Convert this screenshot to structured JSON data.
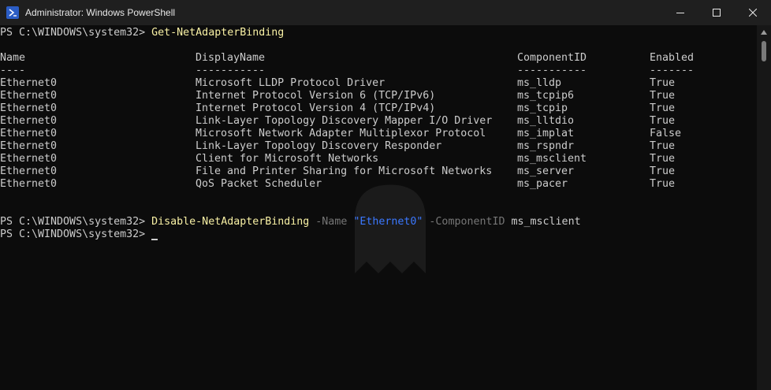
{
  "window": {
    "title": "Administrator: Windows PowerShell",
    "icon": "powershell-icon",
    "controls": [
      "minimize-icon",
      "maximize-icon",
      "close-icon"
    ]
  },
  "terminal": {
    "prompt": "PS C:\\WINDOWS\\system32> ",
    "cmd1": "Get-NetAdapterBinding",
    "headers": [
      "Name",
      "DisplayName",
      "ComponentID",
      "Enabled"
    ],
    "separators": [
      "----",
      "-----------",
      "-----------",
      "-------"
    ],
    "rows": [
      [
        "Ethernet0",
        "Microsoft LLDP Protocol Driver",
        "ms_lldp",
        "True"
      ],
      [
        "Ethernet0",
        "Internet Protocol Version 6 (TCP/IPv6)",
        "ms_tcpip6",
        "True"
      ],
      [
        "Ethernet0",
        "Internet Protocol Version 4 (TCP/IPv4)",
        "ms_tcpip",
        "True"
      ],
      [
        "Ethernet0",
        "Link-Layer Topology Discovery Mapper I/O Driver",
        "ms_lltdio",
        "True"
      ],
      [
        "Ethernet0",
        "Microsoft Network Adapter Multiplexor Protocol",
        "ms_implat",
        "False"
      ],
      [
        "Ethernet0",
        "Link-Layer Topology Discovery Responder",
        "ms_rspndr",
        "True"
      ],
      [
        "Ethernet0",
        "Client for Microsoft Networks",
        "ms_msclient",
        "True"
      ],
      [
        "Ethernet0",
        "File and Printer Sharing for Microsoft Networks",
        "ms_server",
        "True"
      ],
      [
        "Ethernet0",
        "QoS Packet Scheduler",
        "ms_pacer",
        "True"
      ]
    ],
    "cmd2": {
      "name": "Disable-NetAdapterBinding",
      "param1": "-Name",
      "value1": "\"Ethernet0\"",
      "param2": "-ComponentID",
      "value2": "ms_msclient"
    }
  },
  "colors": {
    "background": "#0c0c0c",
    "titlebar": "#1f1f1f",
    "text": "#cccccc",
    "command": "#f9f1a5",
    "parameter": "#767676",
    "string": "#3b78ff"
  }
}
